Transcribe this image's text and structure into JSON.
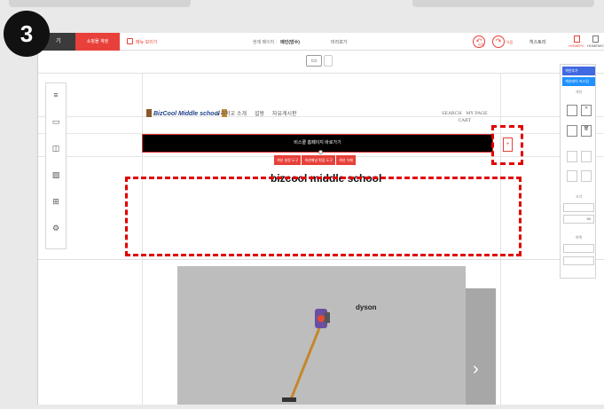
{
  "step_badge": "3",
  "topbar": {
    "dark_label": "기",
    "shop_manage": "쇼핑몰 계정",
    "menu_toggle": "메뉴 보이기",
    "current_page_label": "현재 페이지 :",
    "current_page_value": "메인(방수)",
    "preview": "미리보기",
    "undo": "이전",
    "redo": "다음",
    "history": "히스토리",
    "pc_label": "HOMEPC",
    "mobile_label": "HOMEMO"
  },
  "site": {
    "logo_text": "BizCool Middle school",
    "nav": [
      "우리학교 소개",
      "설왕",
      "자유게시판"
    ],
    "nav_right": [
      "SEARCH",
      "MY PAGE",
      "CART"
    ],
    "banner_text": "비스쿨 홈페이지 바로가기",
    "banner_buttons": [
      "섹션 설정 도구",
      "섹션패널 편집 도구",
      "섹션 삭제"
    ],
    "school_title": "bizcool middle school",
    "product_brand": "dyson",
    "add_icon": "+"
  },
  "right_panel": {
    "btn_add_section": "섹션추가",
    "btn_layout": "섹션레이 커스텀",
    "label_size": "크기",
    "size_value": "50",
    "label_margin": "여백",
    "label_section": "섹션"
  },
  "colors": {
    "accent": "#e8403a",
    "highlight_dash": "#e00000",
    "panel_blue": "#4169e1"
  }
}
